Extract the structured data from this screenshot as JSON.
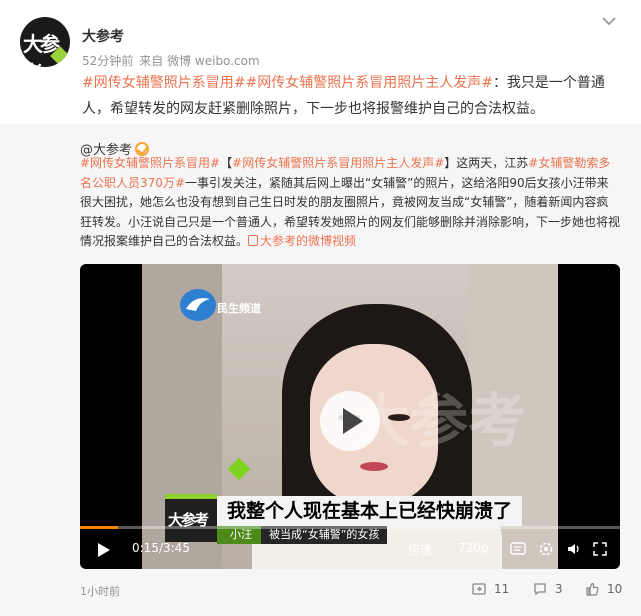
{
  "post": {
    "author_name": "大参考",
    "time": "52分钟前",
    "source": "来自 微博 weibo.com",
    "topic_1": "#网传女辅警照片系冒用#",
    "topic_2": "#网传女辅警照片系冒用照片主人发声#",
    "body": "：我只是一个普通人，希望转发的网友赶紧删除照片，下一步也将报警维护自己的合法权益。"
  },
  "repost": {
    "author": "@大参考",
    "topic_a": "#网传女辅警照片系冒用#",
    "bracket_open": "【",
    "topic_b": "#网传女辅警照片系冒用照片主人发声#",
    "text_1": "】这两天，江苏",
    "topic_c": "#女辅警勒索多名公职人员370万#",
    "text_2": "一事引发关注，紧随其后网上曝出“女辅警”的照片，这给洛阳90后女孩小汪带来很大困扰，她怎么也没有想到自己生日时发的朋友圈照片，竟被网友当成“女辅警”，随着新闻内容疯狂转发。小汪说自己只是一个普通人，希望转发她照片的网友们能够删除并消除影响，下一步她也将视情况报案维护自己的合法权益。",
    "video_link": "大参考的微博视频",
    "video": {
      "station_name": "民生频道",
      "watermark": "大参考",
      "corner_logo": "大参考",
      "subtitle": "我整个人现在基本上已经快崩溃了",
      "speaker_name": "小汪",
      "speaker_desc": "被当成“女辅警”的女孩",
      "current_time": "0:15",
      "total_time": "3:45",
      "progress_fraction": 0.07,
      "speed_label": "倍速",
      "quality_label": "720p"
    },
    "posted_time": "1小时前",
    "repost_count": "11",
    "comment_count": "3",
    "like_count": "10"
  },
  "colors": {
    "topic": "#eb7350",
    "progress": "#ff8200",
    "brand_green": "#8ccf2f"
  },
  "icons": [
    "chevron-down-icon",
    "verified-icon",
    "video-link-icon",
    "play-icon",
    "danmaku-icon",
    "settings-icon",
    "volume-icon",
    "fullscreen-icon",
    "repost-icon",
    "comment-icon",
    "like-icon"
  ]
}
